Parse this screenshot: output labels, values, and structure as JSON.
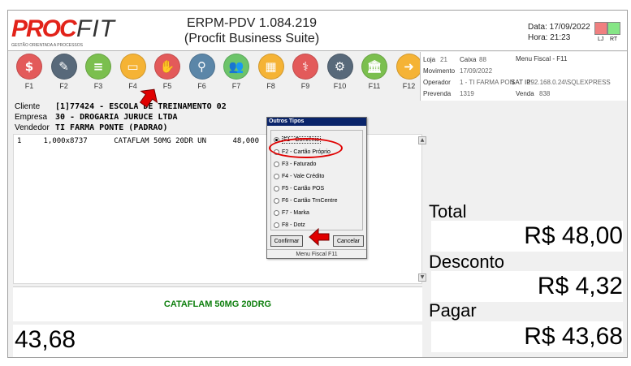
{
  "app": {
    "logo_pro": "PROC",
    "logo_fit": "FIT",
    "logo_tagline": "GESTÃO ORIENTADA A PROCESSOS",
    "title_line1": "ERPM-PDV 1.084.219",
    "title_line2": "(Procfit Business Suite)",
    "date_label": "Data: 17/09/2022",
    "time_label": "Hora: 21:23",
    "light_left": "LJ",
    "light_right": "RT"
  },
  "toolbar": [
    {
      "key": "F1",
      "icon": "money-icon",
      "color": "#e35a5a",
      "glyph": "$"
    },
    {
      "key": "F2",
      "icon": "pen-icon",
      "color": "#58697a",
      "glyph": "✎"
    },
    {
      "key": "F3",
      "icon": "check-icon",
      "color": "#7bbf4e",
      "glyph": "≡"
    },
    {
      "key": "F4",
      "icon": "card-icon",
      "color": "#f5b335",
      "glyph": "▭"
    },
    {
      "key": "F5",
      "icon": "hand-card-icon",
      "color": "#e35a5a",
      "glyph": "✋"
    },
    {
      "key": "F6",
      "icon": "search-icon",
      "color": "#5b86a8",
      "glyph": "⚲"
    },
    {
      "key": "F7",
      "icon": "people-icon",
      "color": "#6cc46a",
      "glyph": "👥"
    },
    {
      "key": "F8",
      "icon": "calculator-icon",
      "color": "#f5b335",
      "glyph": "▦"
    },
    {
      "key": "F9",
      "icon": "caduceus-icon",
      "color": "#e35a5a",
      "glyph": "⚕"
    },
    {
      "key": "F10",
      "icon": "gears-icon",
      "color": "#58697a",
      "glyph": "⚙"
    },
    {
      "key": "F11",
      "icon": "bank-icon",
      "color": "#7bbf4e",
      "glyph": "🏛"
    },
    {
      "key": "F12",
      "icon": "arrow-right-icon",
      "color": "#f5b335",
      "glyph": "➜"
    }
  ],
  "info": {
    "loja_label": "Loja",
    "loja_value": "21",
    "caixa_label": "Caixa",
    "caixa_value": "88",
    "menu_label": "Menu Fiscal - F11",
    "movimento_label": "Movimento",
    "movimento_value": "17/09/2022",
    "operador_label": "Operador",
    "operador_value": "1 - TI FARMA PON",
    "sat_label": "SAT IP",
    "sat_value": "192.168.0.24\\SQLEXPRESS",
    "prevenda_label": "Prevenda",
    "prevenda_value": "1319",
    "venda_label": "Venda",
    "venda_value": "838"
  },
  "client": {
    "cliente_label": "Cliente",
    "cliente_value": "[1]77424 - ESCOLA DE TREINAMENTO 02",
    "empresa_label": "Empresa",
    "empresa_value": "30 - DROGARIA JURUCE LTDA",
    "vendedor_label": "Vendedor",
    "vendedor_value": "TI FARMA PONTE (PADRAO)"
  },
  "items": [
    {
      "text": "1     1,000x8737      CATAFLAM 50MG 20DR UN      48,000"
    }
  ],
  "product_name": "CATAFLAM 50MG 20DRG",
  "big_value": "43,68",
  "totals": {
    "total_label": "Total",
    "total_value": "R$ 48,00",
    "desconto_label": "Desconto",
    "desconto_value": "R$ 4,32",
    "pagar_label": "Pagar",
    "pagar_value": "R$ 43,68"
  },
  "dialog": {
    "title": "Outros Tipos",
    "options": [
      "F1 - Convênio",
      "F2 - Cartão Próprio",
      "F3 - Faturado",
      "F4 - Vale Crédito",
      "F5 - Cartão POS",
      "F6 - Cartão TrnCentre",
      "F7 - Marka",
      "F8 - Dotz"
    ],
    "selected_index": 0,
    "confirm_label": "Confirmar",
    "cancel_label": "Cancelar",
    "status": "Menu Fiscal F11"
  },
  "colors": {
    "annotation_red": "#e00000",
    "dialog_title_bg": "#0a246a",
    "product_green": "#108010"
  }
}
